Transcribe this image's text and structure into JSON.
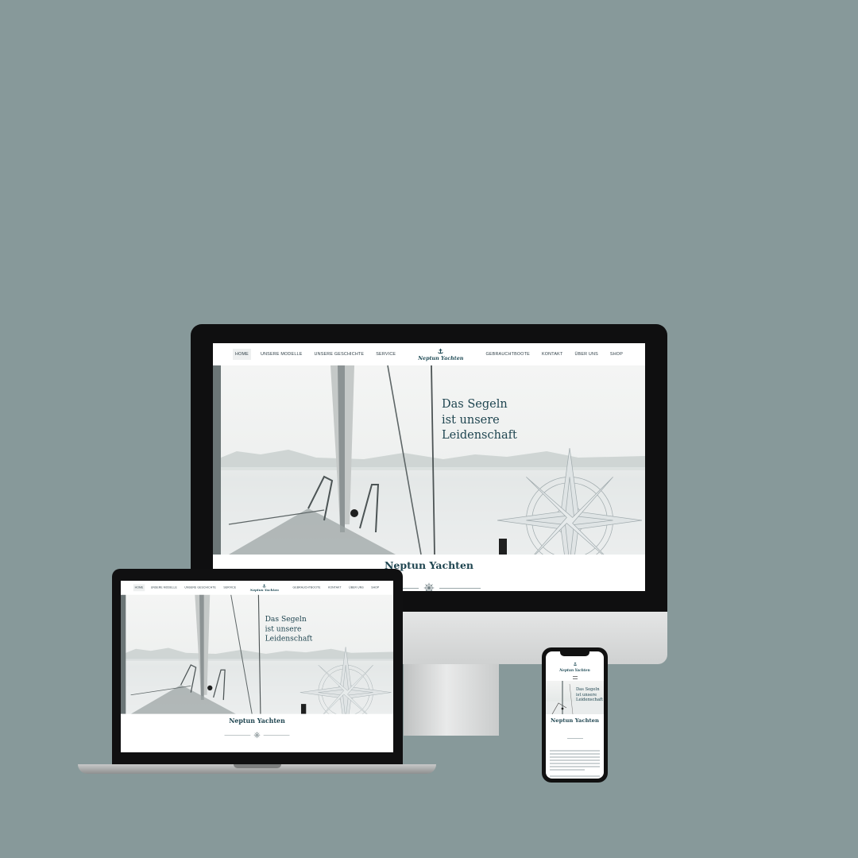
{
  "site": {
    "nav_left": [
      "HOME",
      "UNSERE MODELLE",
      "UNSERE GESCHICHTE",
      "SERVICE"
    ],
    "nav_right": [
      "GEBRAUCHTBOOTE",
      "KONTAKT",
      "ÜBER UNS",
      "SHOP"
    ],
    "logo_text": "Neptun Yachten",
    "headline": [
      "Das Segeln",
      "ist unsere",
      "Leidenschaft"
    ],
    "brand_title": "Neptun Yachten"
  },
  "phone": {
    "logo_text": "Neptun Yachten",
    "headline": [
      "Das Segeln",
      "ist unsere",
      "Leidenschaft"
    ],
    "brand_title": "Neptun Yachten"
  },
  "colors": {
    "background": "#87999a",
    "brand": "#1f4550",
    "nav_text": "#2d3d45"
  },
  "icons": [
    "anchor-logo-icon",
    "compass-rose-icon",
    "ship-wheel-icon",
    "hamburger-menu-icon"
  ]
}
